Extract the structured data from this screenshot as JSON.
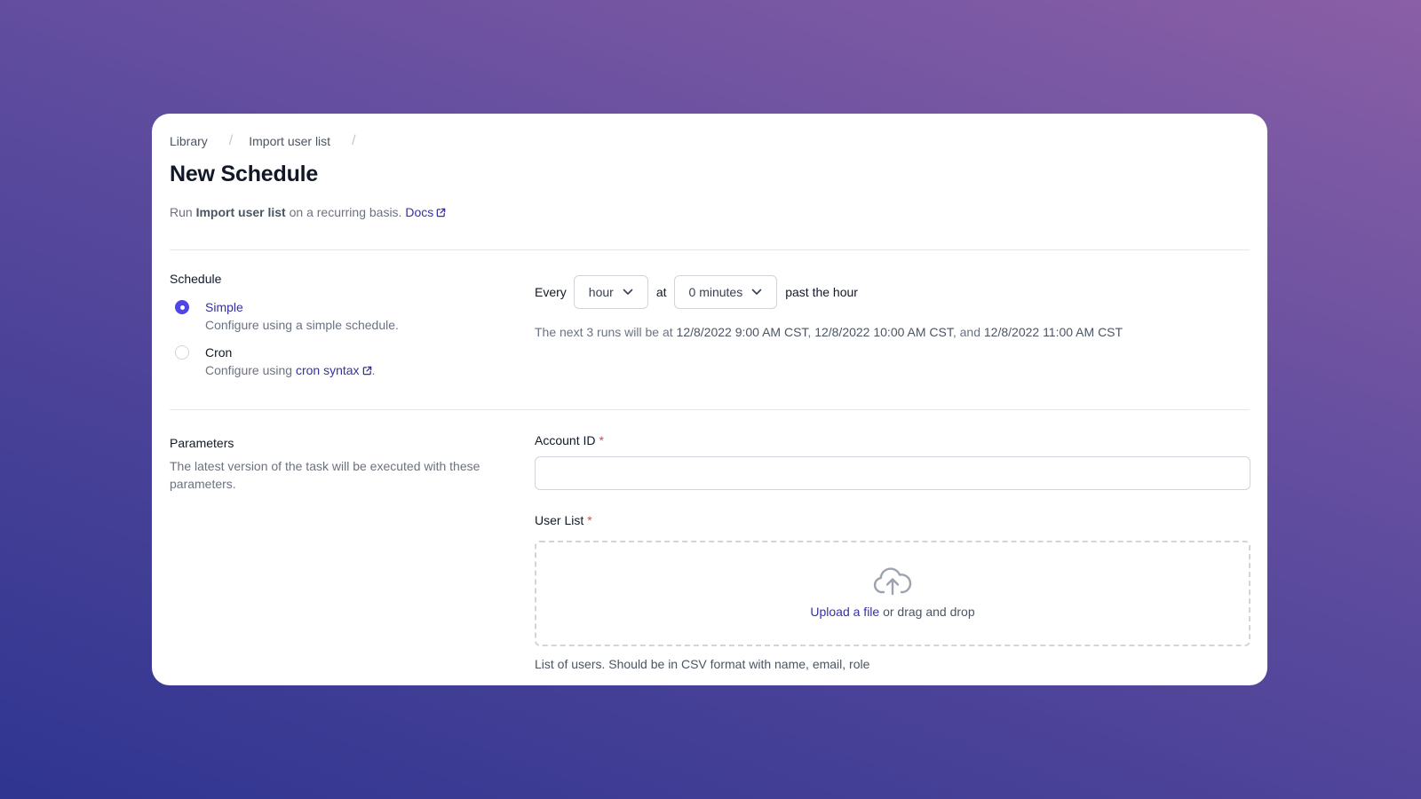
{
  "breadcrumb": {
    "items": [
      "Library",
      "Import user list"
    ],
    "separator": "/"
  },
  "page": {
    "title": "New Schedule",
    "subtitle_prefix": "Run",
    "task_name": "Import user list",
    "subtitle_suffix": "on a recurring basis.",
    "docs_link": "Docs"
  },
  "schedule": {
    "label": "Schedule",
    "options": [
      {
        "title": "Simple",
        "description": "Configure using a simple schedule.",
        "selected": true
      },
      {
        "title": "Cron",
        "description_prefix": "Configure using",
        "description_link": "cron syntax",
        "description_suffix": ".",
        "selected": false
      }
    ],
    "every_label": "Every",
    "interval_value": "hour",
    "at_label": "at",
    "minutes_value": "0 minutes",
    "past_label": "past the hour",
    "next_runs_prefix": "The next 3 runs will be at",
    "runs": [
      "12/8/2022 9:00 AM CST",
      "12/8/2022 10:00 AM CST",
      "12/8/2022 11:00 AM CST"
    ],
    "runs_sep": ",",
    "runs_and": ", and"
  },
  "parameters": {
    "label": "Parameters",
    "description": "The latest version of the task will be executed with these parameters.",
    "account_id": {
      "label": "Account ID",
      "required_mark": "*",
      "value": ""
    },
    "user_list": {
      "label": "User List",
      "required_mark": "*",
      "upload_link": "Upload a file",
      "upload_suffix": "or drag and drop",
      "helper": "List of users. Should be in CSV format with name, email, role"
    }
  },
  "icons": {
    "external_link": "external-link-icon",
    "chevron": "chevron-down-icon",
    "upload": "cloud-upload-icon"
  },
  "colors": {
    "accent": "#4f46e5",
    "link": "#3730a3",
    "required": "#ef4444",
    "background_gradient": [
      "#8a5fa6",
      "#2f3590"
    ]
  }
}
